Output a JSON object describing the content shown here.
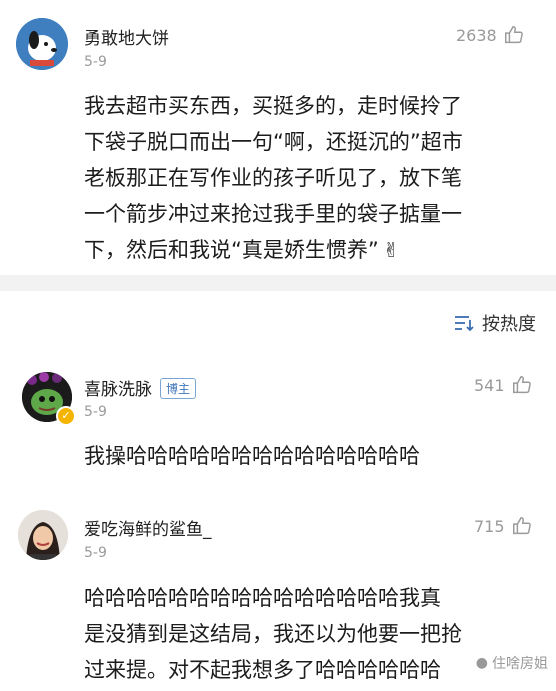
{
  "post": {
    "author": "勇敢地大饼",
    "date": "5-9",
    "likes": "2638",
    "text_lines": [
      "我去超市买东西，买挺多的，走时候拎了",
      "下袋子脱口而出一句“啊，还挺沉的”超市",
      "老板那正在写作业的孩子听见了，放下笔",
      "一个箭步冲过来抢过我手里的袋子掂量一",
      "下，然后和我说“真是娇生惯养”"
    ],
    "emoji_icon": "victory-hand-icon"
  },
  "sort": {
    "label": "按热度",
    "icon": "sort-icon"
  },
  "comments": [
    {
      "author": "喜脉洗脉",
      "badge": "博主",
      "date": "5-9",
      "likes": "541",
      "text_lines": [
        "我操哈哈哈哈哈哈哈哈哈哈哈哈哈哈"
      ]
    },
    {
      "author": "爱吃海鲜的鲨鱼_",
      "date": "5-9",
      "likes": "715",
      "text_lines": [
        "哈哈哈哈哈哈哈哈哈哈哈哈哈哈哈我真",
        "是没猜到是这结局，我还以为他要一把抢",
        "过来提。对不起我想多了哈哈哈哈哈哈"
      ]
    }
  ],
  "watermark": "住啥房姐",
  "colors": {
    "divider": "#f2f2f2",
    "meta": "#9a9a9a",
    "badge": "#3f76b7"
  }
}
